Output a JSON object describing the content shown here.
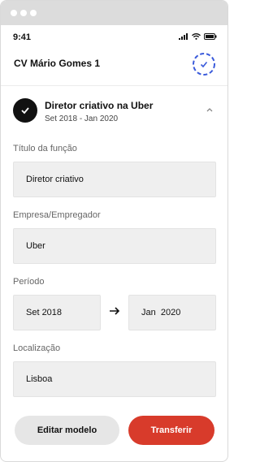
{
  "status_bar": {
    "time": "9:41"
  },
  "header": {
    "title": "CV Mário Gomes 1",
    "progress_icon": "progress-check-icon"
  },
  "job": {
    "title": "Diretor criativo na Uber",
    "dates": "Set 2018 - Jan 2020",
    "collapse_icon": "chevron-up-icon"
  },
  "form": {
    "job_title": {
      "label": "Título da função",
      "value": "Diretor criativo"
    },
    "employer": {
      "label": "Empresa/Empregador",
      "value": "Uber"
    },
    "period": {
      "label": "Período",
      "start": "Set 2018",
      "end": "Jan  2020"
    },
    "location": {
      "label": "Localização",
      "value": "Lisboa"
    }
  },
  "actions": {
    "edit_template": "Editar modelo",
    "download": "Transferir"
  },
  "colors": {
    "accent": "#d83b2b",
    "progress_blue": "#3b5bdb"
  }
}
